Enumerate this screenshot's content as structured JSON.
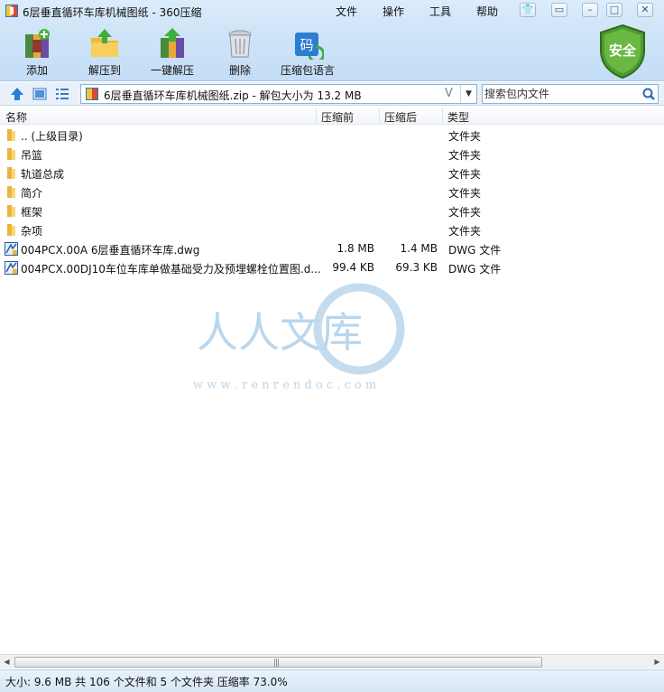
{
  "window": {
    "title": "6层垂直循环车库机械图纸 - 360压缩",
    "menu": [
      "文件",
      "操作",
      "工具",
      "帮助"
    ]
  },
  "toolbar": {
    "items": [
      {
        "label": "添加",
        "icon": "add-archive-icon"
      },
      {
        "label": "解压到",
        "icon": "extract-to-icon"
      },
      {
        "label": "一键解压",
        "icon": "one-click-extract-icon"
      },
      {
        "label": "删除",
        "icon": "trash-bin-icon"
      },
      {
        "label": "压缩包语言",
        "icon": "archive-language-icon"
      }
    ],
    "security_badge": "安全",
    "colors": {
      "badge": "#5aa83a",
      "toolbar_bg": "#cfe4f8"
    }
  },
  "address": {
    "path": "6层垂直循环车库机械图纸.zip - 解包大小为 13.2 MB",
    "v_mark": "V",
    "search_placeholder": "搜索包内文件"
  },
  "columns": {
    "name": "名称",
    "compressed": "压缩前",
    "decompressed": "压缩后",
    "type": "类型"
  },
  "files": [
    {
      "name": ".. (上级目录)",
      "before": "",
      "after": "",
      "type": "文件夹",
      "icon": "folder-icon"
    },
    {
      "name": "吊篮",
      "before": "",
      "after": "",
      "type": "文件夹",
      "icon": "folder-icon"
    },
    {
      "name": "轨道总成",
      "before": "",
      "after": "",
      "type": "文件夹",
      "icon": "folder-icon"
    },
    {
      "name": "简介",
      "before": "",
      "after": "",
      "type": "文件夹",
      "icon": "folder-icon"
    },
    {
      "name": "框架",
      "before": "",
      "after": "",
      "type": "文件夹",
      "icon": "folder-icon"
    },
    {
      "name": "杂项",
      "before": "",
      "after": "",
      "type": "文件夹",
      "icon": "folder-icon"
    },
    {
      "name": "004PCX.00A 6层垂直循环车库.dwg",
      "before": "1.8 MB",
      "after": "1.4 MB",
      "type": "DWG 文件",
      "icon": "dwg-file-icon"
    },
    {
      "name": "004PCX.00DJ10车位车库单做基础受力及预埋螺栓位置图.d...",
      "before": "99.4 KB",
      "after": "69.3 KB",
      "type": "DWG 文件",
      "icon": "dwg-file-icon"
    }
  ],
  "watermark": {
    "text": "人人文库",
    "url": "w w w . r e n r e n d o c . c o m"
  },
  "status": {
    "text": "大小: 9.6 MB 共 106 个文件和 5 个文件夹 压缩率 73.0%"
  }
}
